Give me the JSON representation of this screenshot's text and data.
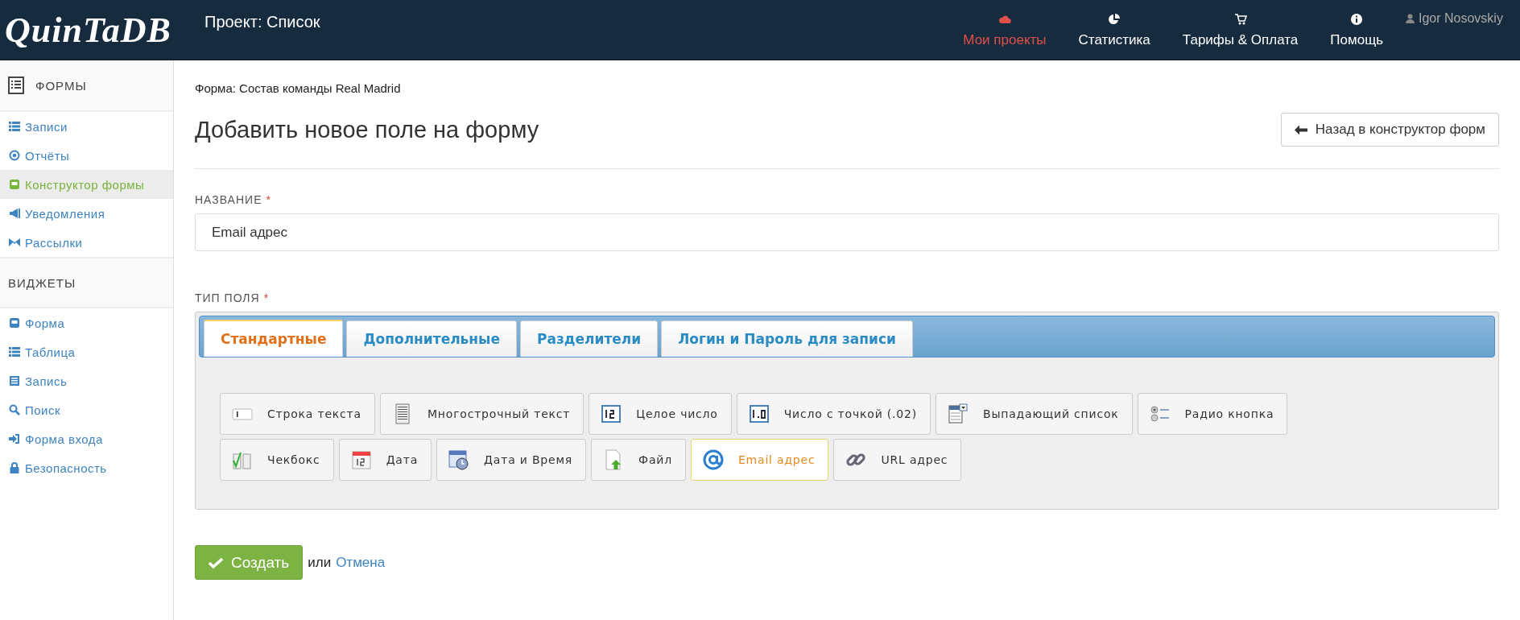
{
  "header": {
    "logo": "QuinTaDB",
    "project_title": "Проект: Список",
    "nav": [
      {
        "label": "Мои проекты",
        "selected": true
      },
      {
        "label": "Статистика",
        "selected": false
      },
      {
        "label": "Тарифы & Оплата",
        "selected": false
      },
      {
        "label": "Помощь",
        "selected": false
      }
    ],
    "user": "Igor Nosovskiy"
  },
  "sidebar": {
    "sections": [
      {
        "title": "ФОРМЫ",
        "items": [
          {
            "label": "Записи",
            "selected": false
          },
          {
            "label": "Отчёты",
            "selected": false
          },
          {
            "label": "Конструктор формы",
            "selected": true
          },
          {
            "label": "Уведомления",
            "selected": false
          },
          {
            "label": "Рассылки",
            "selected": false
          }
        ]
      },
      {
        "title": "ВИДЖЕТЫ",
        "items": [
          {
            "label": "Форма",
            "selected": false
          },
          {
            "label": "Таблица",
            "selected": false
          },
          {
            "label": "Запись",
            "selected": false
          },
          {
            "label": "Поиск",
            "selected": false
          },
          {
            "label": "Форма входа",
            "selected": false
          },
          {
            "label": "Безопасность",
            "selected": false
          }
        ]
      }
    ]
  },
  "breadcrumb": "Форма: Состав команды Real Madrid",
  "page_title": "Добавить новое поле на форму",
  "back_button": "Назад в конструктор форм",
  "name_field": {
    "label": "НАЗВАНИЕ",
    "required_mark": "*",
    "value": "Email адрес"
  },
  "type_field": {
    "label": "ТИП ПОЛЯ",
    "required_mark": "*",
    "tabs": [
      {
        "label": "Стандартные",
        "selected": true
      },
      {
        "label": "Дополнительные",
        "selected": false
      },
      {
        "label": "Разделители",
        "selected": false
      },
      {
        "label": "Логин и Пароль для записи",
        "selected": false
      }
    ],
    "types": [
      {
        "label": "Строка текста",
        "selected": false
      },
      {
        "label": "Многострочный текст",
        "selected": false
      },
      {
        "label": "Целое число",
        "selected": false
      },
      {
        "label": "Число с точкой (.02)",
        "selected": false
      },
      {
        "label": "Выпадающий список",
        "selected": false
      },
      {
        "label": "Радио кнопка",
        "selected": false
      },
      {
        "label": "Чекбокс",
        "selected": false
      },
      {
        "label": "Дата",
        "selected": false
      },
      {
        "label": "Дата и Время",
        "selected": false
      },
      {
        "label": "Файл",
        "selected": false
      },
      {
        "label": "Email адрес",
        "selected": true
      },
      {
        "label": "URL адрес",
        "selected": false
      }
    ]
  },
  "actions": {
    "submit": "Создать",
    "separator": "или",
    "cancel": "Отмена"
  }
}
